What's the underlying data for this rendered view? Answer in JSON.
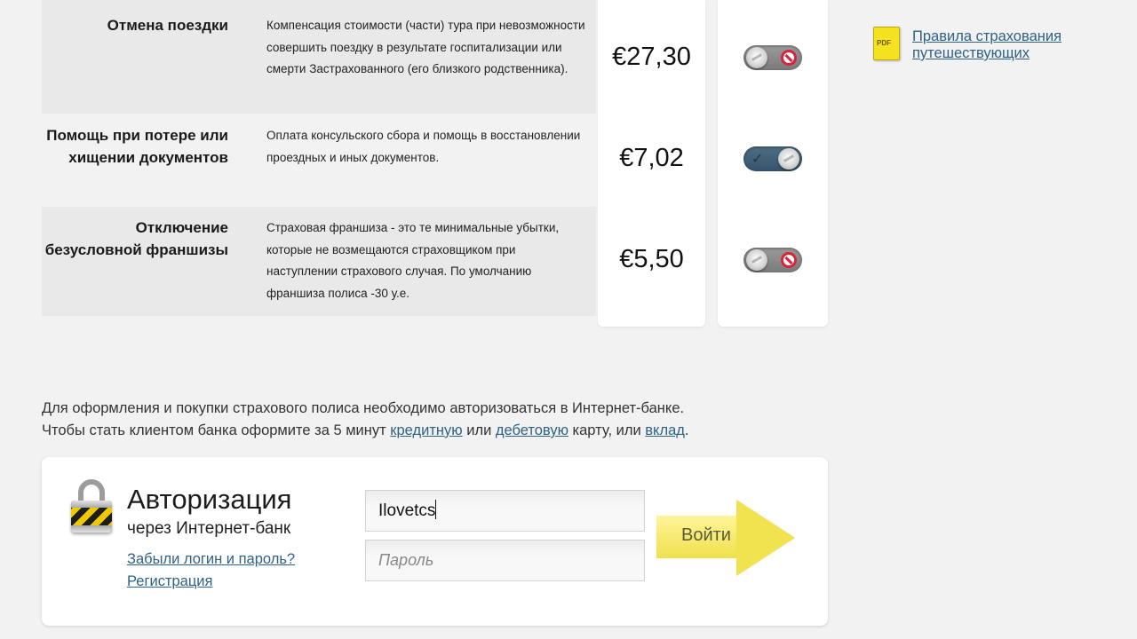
{
  "options": [
    {
      "name": "Отмена поездки",
      "description": "Компенсация стоимости (части) тура при невозможности совершить поездку в результате госпитализации или смерти Застрахованного (его близкого родственника).",
      "price": "€27,30",
      "enabled": false
    },
    {
      "name": "Помощь при потере или хищении документов",
      "description": "Оплата консульского сбора и помощь в восстановлении проездных и иных документов.",
      "price": "€7,02",
      "enabled": true
    },
    {
      "name": "Отключение безусловной франшизы",
      "description": "Страховая франшиза - это те минимальные убытки, которые не возмещаются страховщиком при наступлении страхового случая. По умолчанию франшиза полиса -30 у.е.",
      "price": "€5,50",
      "enabled": false
    }
  ],
  "sidebar": {
    "pdf_icon_text": "PDF",
    "rules_link": "Правила страхования путешествующих"
  },
  "info": {
    "line1": "Для оформления и покупки страхового полиса необходимо авторизоваться в Интернет-банке.",
    "line2_prefix": "Чтобы стать клиентом банка оформите за 5 минут ",
    "credit_link": "кредитную",
    "or1": " или ",
    "debit_link": "дебетовую",
    "card_or": " карту, или ",
    "deposit_link": "вклад",
    "period": "."
  },
  "auth": {
    "title": "Авторизация",
    "subtitle": "через Интернет-банк",
    "forgot_link": "Забыли логин и пароль?",
    "register_link": "Регистрация",
    "login_value": "Ilovetcs",
    "password_placeholder": "Пароль",
    "submit_label": "Войти"
  },
  "colors": {
    "link": "#2f6185",
    "toggle_on": "#35546b",
    "submit_arrow": "#f1e24f"
  }
}
